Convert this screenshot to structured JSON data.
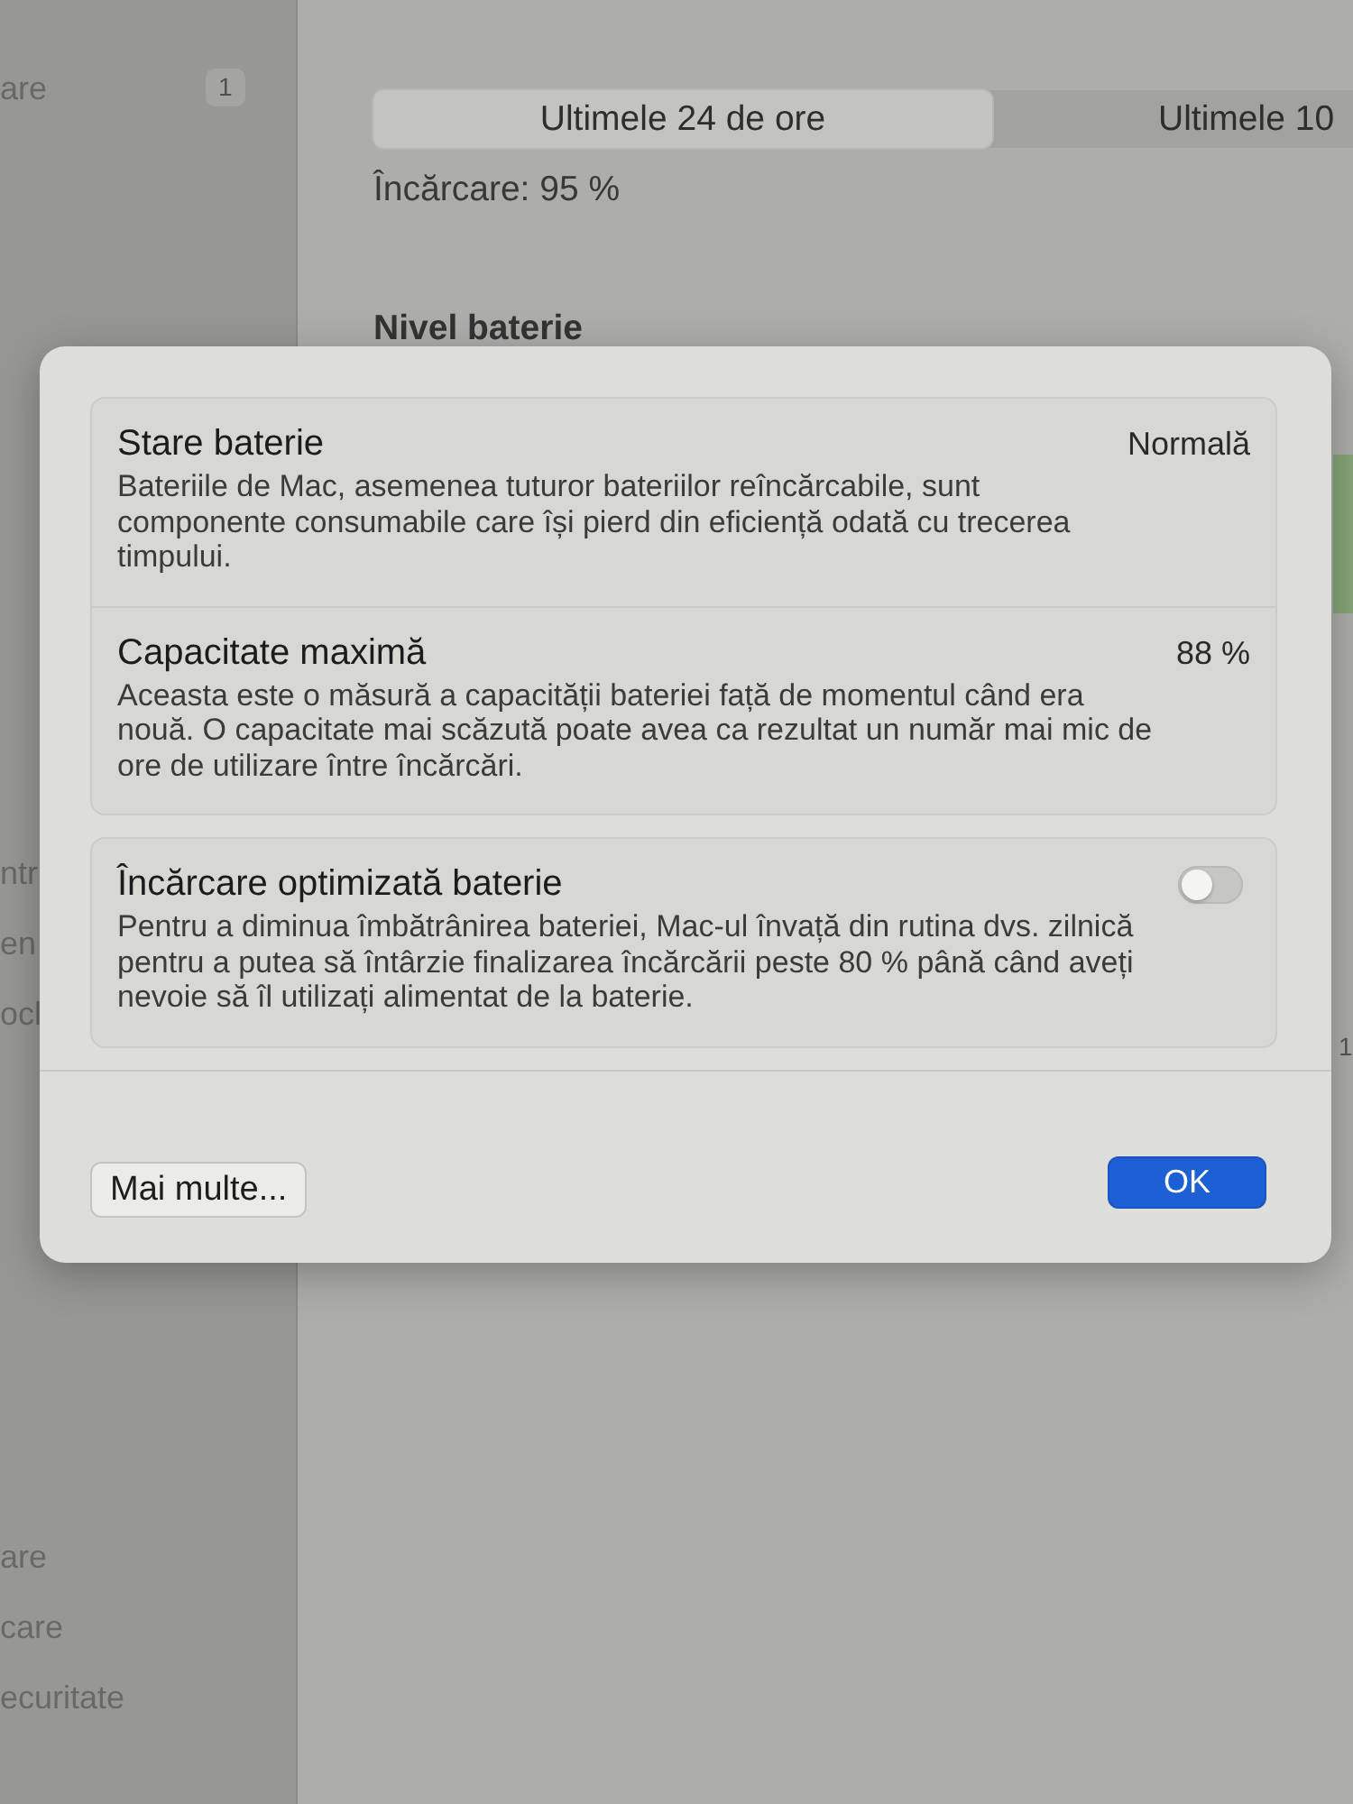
{
  "sidebar": {
    "groups": [
      {
        "items": [
          {
            "label": "are",
            "badge": "1"
          }
        ]
      },
      {
        "items": [
          {
            "label": "ntr"
          },
          {
            "label": "en"
          },
          {
            "label": "ocl"
          }
        ]
      },
      {
        "items": [
          {
            "label": "are"
          },
          {
            "label": "care"
          },
          {
            "label": "ecuritate"
          }
        ]
      }
    ]
  },
  "main": {
    "segments": [
      {
        "label": "Ultimele 24 de ore",
        "selected": true
      },
      {
        "label": "Ultimele 10",
        "selected": false
      }
    ],
    "charge": "Încărcare: 95 %",
    "section_title": "Nivel baterie",
    "axis_label": "1"
  },
  "dialog": {
    "groups": [
      {
        "rows": [
          {
            "kind": "value",
            "title": "Stare baterie",
            "value": "Normală",
            "description": "Bateriile de Mac, asemenea tuturor bateriilor reîncărcabile, sunt componente consumabile care își pierd din eficiență odată cu trecerea timpului."
          },
          {
            "kind": "value",
            "title": "Capacitate maximă",
            "value": "88 %",
            "description": "Aceasta este o măsură a capacității bateriei față de momentul când era nouă. O capacitate mai scăzută poate avea ca rezultat un număr mai mic de ore de utilizare între încărcări."
          }
        ]
      },
      {
        "rows": [
          {
            "kind": "toggle",
            "title": "Încărcare optimizată baterie",
            "on": false,
            "description": "Pentru a diminua îmbătrânirea bateriei, Mac-ul învață din rutina dvs. zilnică pentru a putea să întârzie finalizarea încărcării peste 80 % până când aveți nevoie să îl utilizați alimentat de la baterie."
          }
        ]
      }
    ],
    "buttons": [
      {
        "kind": "secondary",
        "label": "Mai multe..."
      },
      {
        "kind": "primary",
        "label": "OK"
      }
    ]
  }
}
